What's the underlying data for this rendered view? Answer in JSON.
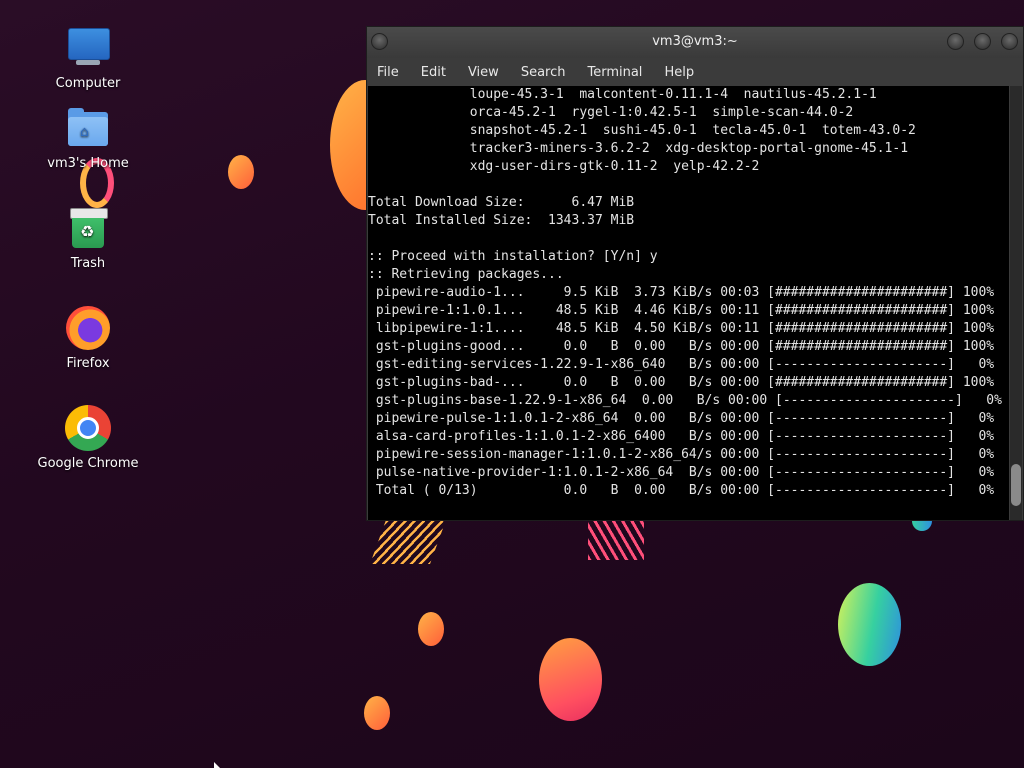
{
  "desktop": {
    "icons": [
      {
        "label": "Computer",
        "icon": "computer-icon"
      },
      {
        "label": "vm3's Home",
        "icon": "home-folder-icon"
      },
      {
        "label": "Trash",
        "icon": "trash-icon"
      },
      {
        "label": "Firefox",
        "icon": "firefox-icon"
      },
      {
        "label": "Google Chrome",
        "icon": "chrome-icon"
      }
    ]
  },
  "window": {
    "title": "vm3@vm3:~",
    "menu": [
      "File",
      "Edit",
      "View",
      "Search",
      "Terminal",
      "Help"
    ]
  },
  "terminal": {
    "lines": [
      "             loupe-45.3-1  malcontent-0.11.1-4  nautilus-45.2.1-1",
      "             orca-45.2-1  rygel-1:0.42.5-1  simple-scan-44.0-2",
      "             snapshot-45.2-1  sushi-45.0-1  tecla-45.0-1  totem-43.0-2",
      "             tracker3-miners-3.6.2-2  xdg-desktop-portal-gnome-45.1-1",
      "             xdg-user-dirs-gtk-0.11-2  yelp-42.2-2",
      "",
      "Total Download Size:      6.47 MiB",
      "Total Installed Size:  1343.37 MiB",
      "",
      ":: Proceed with installation? [Y/n] y",
      ":: Retrieving packages...",
      " pipewire-audio-1...     9.5 KiB  3.73 KiB/s 00:03 [######################] 100%",
      " pipewire-1:1.0.1...    48.5 KiB  4.46 KiB/s 00:11 [######################] 100%",
      " libpipewire-1:1....    48.5 KiB  4.50 KiB/s 00:11 [######################] 100%",
      " gst-plugins-good...     0.0   B  0.00   B/s 00:00 [######################] 100%",
      " gst-editing-services-1.22.9-1-x86_640   B/s 00:00 [----------------------]   0%",
      " gst-plugins-bad-...     0.0   B  0.00   B/s 00:00 [######################] 100%",
      " gst-plugins-base-1.22.9-1-x86_64  0.00   B/s 00:00 [----------------------]   0%",
      " pipewire-pulse-1:1.0.1-2-x86_64  0.00   B/s 00:00 [----------------------]   0%",
      " alsa-card-profiles-1:1.0.1-2-x86_6400   B/s 00:00 [----------------------]   0%",
      " pipewire-session-manager-1:1.0.1-2-x86_64/s 00:00 [----------------------]   0%",
      " pulse-native-provider-1:1.0.1-2-x86_64  B/s 00:00 [----------------------]   0%",
      " Total ( 0/13)           0.0   B  0.00   B/s 00:00 [----------------------]   0%"
    ]
  }
}
